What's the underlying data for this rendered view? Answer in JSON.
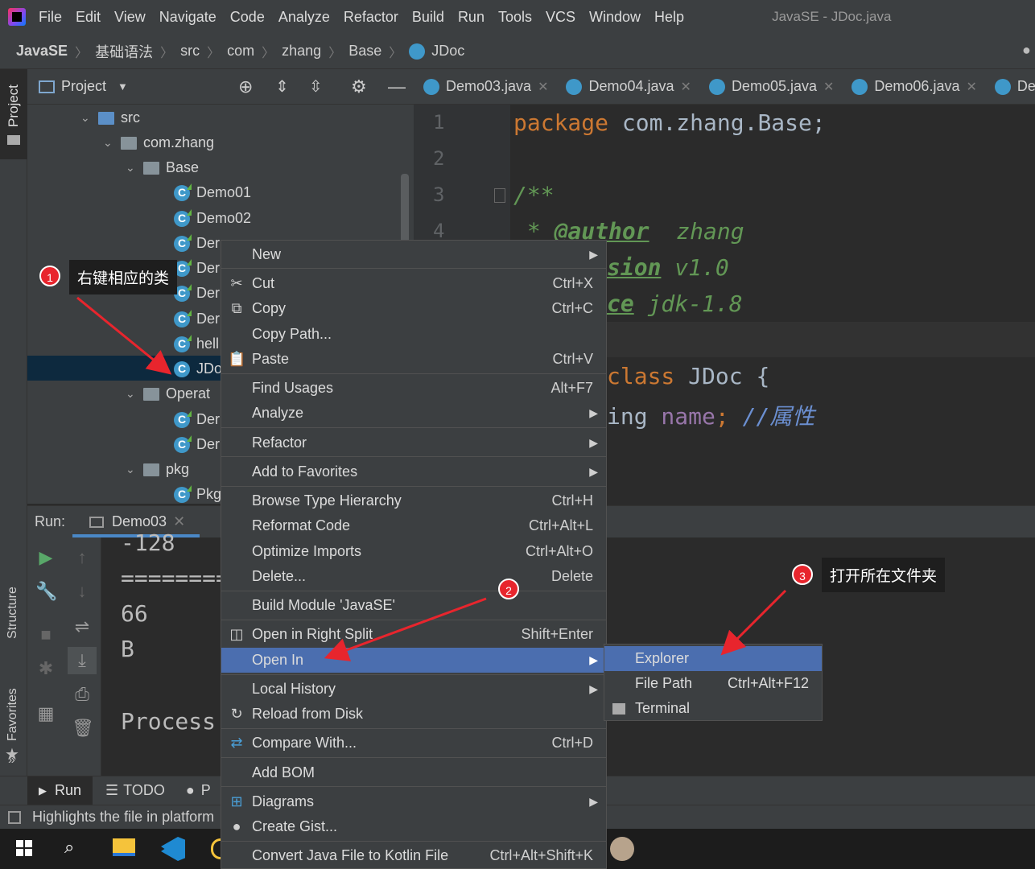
{
  "menubar": {
    "items": [
      "File",
      "Edit",
      "View",
      "Navigate",
      "Code",
      "Analyze",
      "Refactor",
      "Build",
      "Run",
      "Tools",
      "VCS",
      "Window",
      "Help"
    ],
    "title": "JavaSE - JDoc.java"
  },
  "navbar": {
    "crumbs": [
      "JavaSE",
      "基础语法",
      "src",
      "com",
      "zhang",
      "Base",
      "JDoc"
    ]
  },
  "sidebar": {
    "project_tab": "Project",
    "structure_tab": "Structure",
    "favorites_tab": "Favorites"
  },
  "project": {
    "header": "Project",
    "tree": [
      {
        "label": "src"
      },
      {
        "label": "com.zhang"
      },
      {
        "label": "Base"
      },
      {
        "label": "Demo01"
      },
      {
        "label": "Demo02"
      },
      {
        "label": "Der"
      },
      {
        "label": "Der"
      },
      {
        "label": "Der"
      },
      {
        "label": "Der"
      },
      {
        "label": "hell"
      },
      {
        "label": "JDo"
      },
      {
        "label": "Operat"
      },
      {
        "label": "Der"
      },
      {
        "label": "Der"
      },
      {
        "label": "pkg"
      },
      {
        "label": "Pkg"
      }
    ]
  },
  "editor": {
    "tabs": [
      "Demo03.java",
      "Demo04.java",
      "Demo05.java",
      "Demo06.java",
      "De"
    ],
    "line_numbers": [
      "1",
      "2",
      "3",
      "4"
    ],
    "code": {
      "l1_kw": "package",
      "l1_rest": " com.zhang.Base;",
      "l3": "/**",
      "l4_star": " * ",
      "l4_tag": "@author",
      "l4_val": "  zhang",
      "l5_tag": "sion",
      "l5_val": " v1.0",
      "l6_tag": "ce",
      "l6_val": " jdk-1.8",
      "l8_kw": "class",
      "l8_rest": " JDoc {",
      "l9_type": "ing",
      "l9_field": " name",
      "l9_semi": "; ",
      "l9_cmt": "//属性"
    }
  },
  "run": {
    "label": "Run:",
    "tab": "Demo03",
    "output": [
      "-128",
      "========",
      "66",
      "B",
      "",
      "Process"
    ]
  },
  "bottom_tabs": [
    "Run",
    "TODO",
    "P"
  ],
  "status": "Highlights the file in platform",
  "context_menu": {
    "items": [
      {
        "label": "New",
        "shortcut": "",
        "sub": true
      },
      {
        "label": "Cut",
        "shortcut": "Ctrl+X"
      },
      {
        "label": "Copy",
        "shortcut": "Ctrl+C"
      },
      {
        "label": "Copy Path...",
        "shortcut": ""
      },
      {
        "label": "Paste",
        "shortcut": "Ctrl+V"
      },
      {
        "label": "Find Usages",
        "shortcut": "Alt+F7"
      },
      {
        "label": "Analyze",
        "shortcut": "",
        "sub": true
      },
      {
        "label": "Refactor",
        "shortcut": "",
        "sub": true
      },
      {
        "label": "Add to Favorites",
        "shortcut": "",
        "sub": true
      },
      {
        "label": "Browse Type Hierarchy",
        "shortcut": "Ctrl+H"
      },
      {
        "label": "Reformat Code",
        "shortcut": "Ctrl+Alt+L"
      },
      {
        "label": "Optimize Imports",
        "shortcut": "Ctrl+Alt+O"
      },
      {
        "label": "Delete...",
        "shortcut": "Delete"
      },
      {
        "label": "Build Module 'JavaSE'",
        "shortcut": ""
      },
      {
        "label": "Open in Right Split",
        "shortcut": "Shift+Enter"
      },
      {
        "label": "Open In",
        "shortcut": "",
        "sub": true
      },
      {
        "label": "Local History",
        "shortcut": "",
        "sub": true
      },
      {
        "label": "Reload from Disk",
        "shortcut": ""
      },
      {
        "label": "Compare With...",
        "shortcut": "Ctrl+D"
      },
      {
        "label": "Add BOM",
        "shortcut": ""
      },
      {
        "label": "Diagrams",
        "shortcut": "",
        "sub": true
      },
      {
        "label": "Create Gist...",
        "shortcut": ""
      },
      {
        "label": "Convert Java File to Kotlin File",
        "shortcut": "Ctrl+Alt+Shift+K"
      }
    ]
  },
  "submenu": {
    "items": [
      {
        "label": "Explorer",
        "shortcut": ""
      },
      {
        "label": "File Path",
        "shortcut": "Ctrl+Alt+F12"
      },
      {
        "label": "Terminal",
        "shortcut": ""
      }
    ]
  },
  "annotations": {
    "n1": "1",
    "t1": "右键相应的类",
    "n2": "2",
    "n3": "3",
    "t3": "打开所在文件夹"
  }
}
